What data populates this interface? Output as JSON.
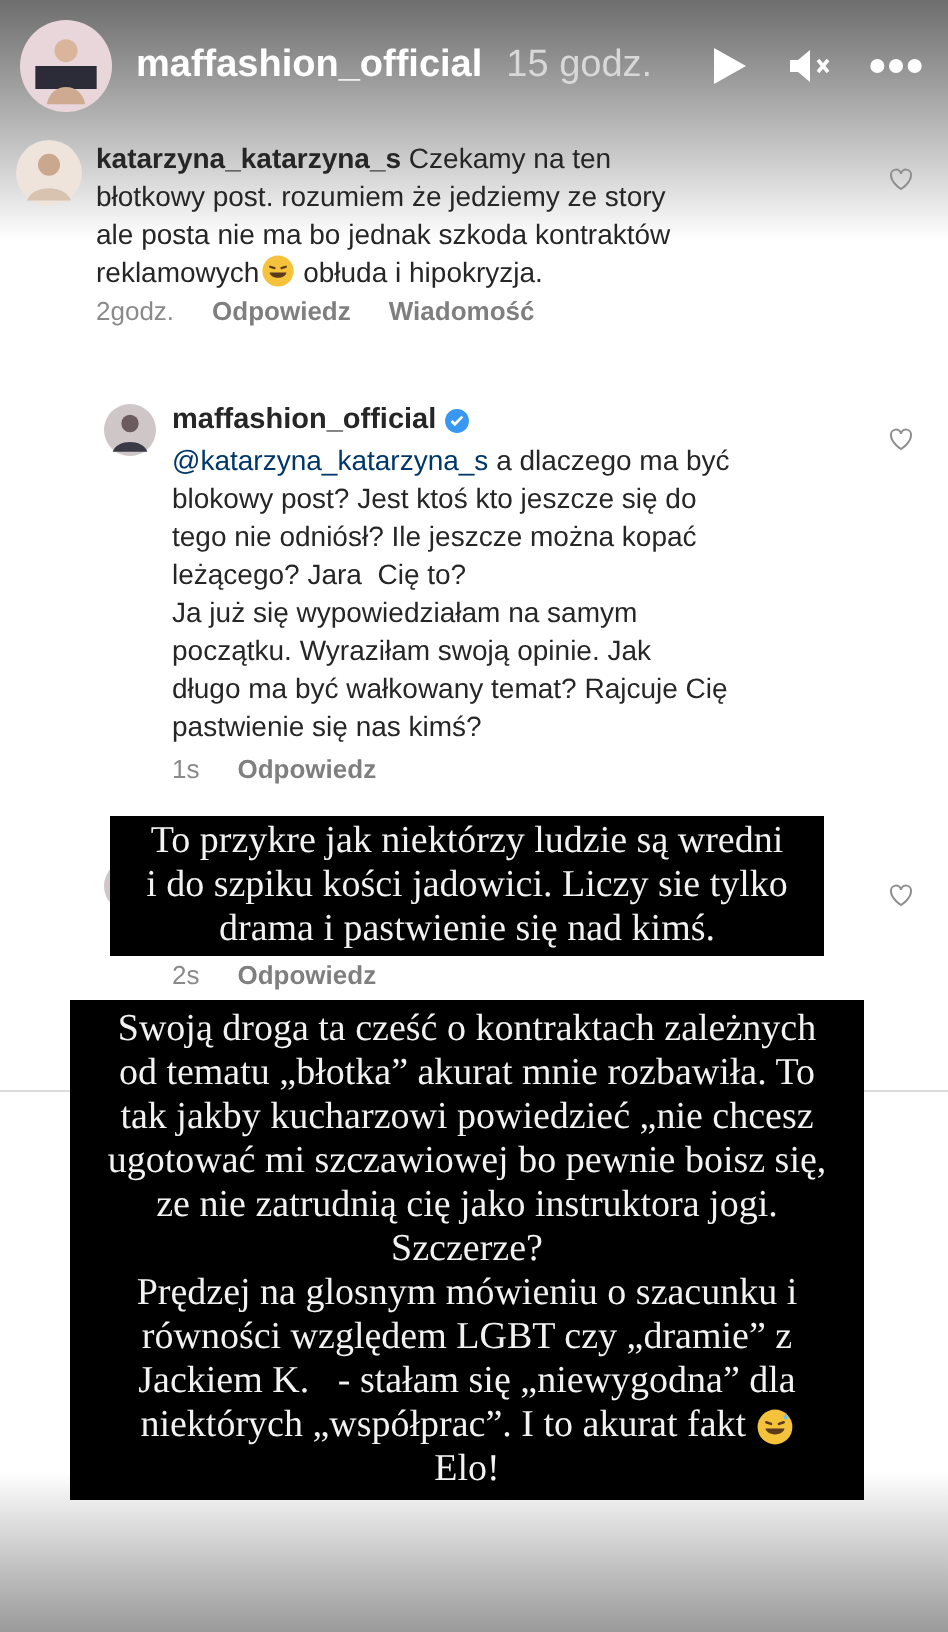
{
  "story_header": {
    "username": "maffashion_official",
    "time": "15 godz."
  },
  "comments": [
    {
      "username": "katarzyna_katarzyna_s",
      "reply": false,
      "lines": [
        [
          {
            "kind": "text",
            "text": " Czekamy na ten"
          }
        ],
        [
          {
            "kind": "text",
            "text": "błotkowy post. rozumiem że jedziemy ze story"
          }
        ],
        [
          {
            "kind": "text",
            "text": "ale posta nie ma bo jednak szkoda kontraktów"
          }
        ],
        [
          {
            "kind": "text",
            "text": "reklamowych"
          },
          {
            "kind": "emoji"
          },
          {
            "kind": "text",
            "text": " obłuda i hipokryzja."
          }
        ]
      ],
      "actions": [
        "2godz.",
        "Odpowiedz",
        "Wiadomość"
      ]
    },
    {
      "username": "maffashion_official",
      "verified": true,
      "reply": true,
      "lines": [
        [
          {
            "kind": "mention",
            "text": "@katarzyna_katarzyna_s"
          },
          {
            "kind": "text",
            "text": " a dlaczego ma być"
          }
        ],
        [
          {
            "kind": "text",
            "text": "blokowy post? Jest ktoś kto jeszcze się do"
          }
        ],
        [
          {
            "kind": "text",
            "text": "tego nie odniósł? Ile jeszcze można kopać"
          }
        ],
        [
          {
            "kind": "text",
            "text": "leżącego? Jara  Cię to?"
          }
        ],
        [
          {
            "kind": "text",
            "text": "Ja już się wypowiedziałam na samym"
          }
        ],
        [
          {
            "kind": "text",
            "text": "początku. Wyraziłam swoją opinie. Jak"
          }
        ],
        [
          {
            "kind": "text",
            "text": "długo ma być wałkowany temat? Rajcuje Cię"
          }
        ],
        [
          {
            "kind": "text",
            "text": "pastwienie się nas kimś?"
          }
        ]
      ],
      "actions": [
        "1s",
        "Odpowiedz"
      ]
    },
    {
      "reply": true,
      "hidden": true,
      "actions": [
        "2s",
        "Odpowiedz"
      ]
    }
  ],
  "captions": [
    {
      "lines": [
        [
          {
            "kind": "text",
            "text": "To przykre jak niektórzy ludzie są wredni"
          }
        ],
        [
          {
            "kind": "text",
            "text": "i do szpiku kości jadowici. Liczy sie tylko"
          }
        ],
        [
          {
            "kind": "text",
            "text": "drama i pastwienie się nad kimś."
          }
        ]
      ]
    },
    {
      "lines": [
        [
          {
            "kind": "text",
            "text": "Swoją droga ta cześć o kontraktach zależnych"
          }
        ],
        [
          {
            "kind": "text",
            "text": "od tematu „błotka” akurat mnie rozbawiła. To"
          }
        ],
        [
          {
            "kind": "text",
            "text": "tak jakby kucharzowi powiedzieć „nie chcesz"
          }
        ],
        [
          {
            "kind": "text",
            "text": "ugotować mi szczawiowej bo pewnie boisz się,"
          }
        ],
        [
          {
            "kind": "text",
            "text": "ze nie zatrudnią cię jako instruktora jogi."
          }
        ],
        [
          {
            "kind": "text",
            "text": "Szczerze?"
          }
        ],
        [
          {
            "kind": "text",
            "text": "Prędzej na glosnym mówieniu o szacunku i"
          }
        ],
        [
          {
            "kind": "text",
            "text": "równości względem LGBT czy „dramie” z"
          }
        ],
        [
          {
            "kind": "text",
            "text": "Jackiem K.   - stałam się „niewygodna” dla"
          }
        ],
        [
          {
            "kind": "text",
            "text": "niektórych „współprac”. I to akurat fakt "
          },
          {
            "kind": "emoji"
          }
        ],
        [
          {
            "kind": "text",
            "text": "Elo!"
          }
        ]
      ]
    }
  ]
}
